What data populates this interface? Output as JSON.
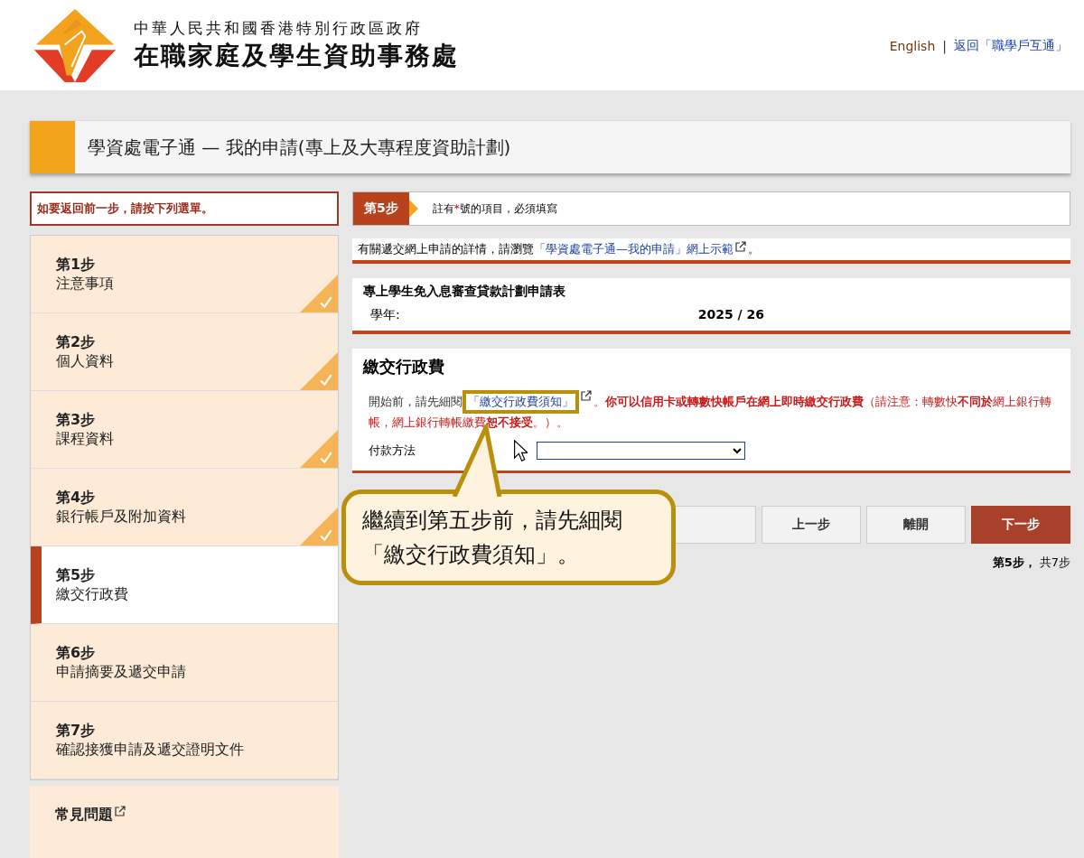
{
  "header": {
    "org_line": "中華人民共和國香港特別行政區政府",
    "agency": "在職家庭及學生資助事務處",
    "separator": "|",
    "links": [
      {
        "label": "English",
        "kind": "lang"
      },
      {
        "label": "返回「職學戶互通」",
        "kind": "nav"
      }
    ]
  },
  "page_title": "學資處電子通 — 我的申請(專上及大專程度資助計劃)",
  "sidebar": {
    "notice": "如要返回前一步，請按下列選單。",
    "steps": [
      {
        "step": "第1步",
        "label": "注意事項",
        "completed": true,
        "selected": false
      },
      {
        "step": "第2步",
        "label": "個人資料",
        "completed": true,
        "selected": false
      },
      {
        "step": "第3步",
        "label": "課程資料",
        "completed": true,
        "selected": false
      },
      {
        "step": "第4步",
        "label": "銀行帳戶及附加資料",
        "completed": true,
        "selected": false
      },
      {
        "step": "第5步",
        "label": "繳交行政費",
        "completed": false,
        "selected": true
      },
      {
        "step": "第6步",
        "label": "申請摘要及遞交申請",
        "completed": false,
        "selected": false
      },
      {
        "step": "第7步",
        "label": "確認接獲申請及遞交證明文件",
        "completed": false,
        "selected": false
      }
    ],
    "faq": "常見問題"
  },
  "step_banner": {
    "badge": "第5步",
    "note_before": "註有",
    "asterisk": "*",
    "note_after": "號的項目，必須填寫"
  },
  "info": {
    "text": "有關遞交網上申請的詳情，請瀏覽",
    "link": "「學資處電子通—我的申請」網上示範",
    "end": "。"
  },
  "form_header": {
    "title": "專上學生免入息審查貸款計劃申請表",
    "year_label": "學年:",
    "year_value": "2025 / 26"
  },
  "section": {
    "title": "繳交行政費",
    "intro": "開始前，請先細閱",
    "link": "「繳交行政費須知」",
    "warning": "。**你可以信用卡或轉數快帳戶在網上即時繳交行政費**（請注意：轉數快**不同於**網上銀行轉帳，網上銀行轉帳繳費**恕不接受**。）。",
    "payment_label": "付款方法"
  },
  "buttons": [
    {
      "label": "上一步",
      "kind": "plain"
    },
    {
      "label": "離開",
      "kind": "plain"
    },
    {
      "label": "下一步",
      "kind": "primary"
    }
  ],
  "progress": {
    "current": "第5步",
    "sep": "，",
    "total": "共7步"
  },
  "callout": {
    "line1": "繼續到第五步前，請先細閱",
    "line2": "「繳交行政費須知」。"
  }
}
